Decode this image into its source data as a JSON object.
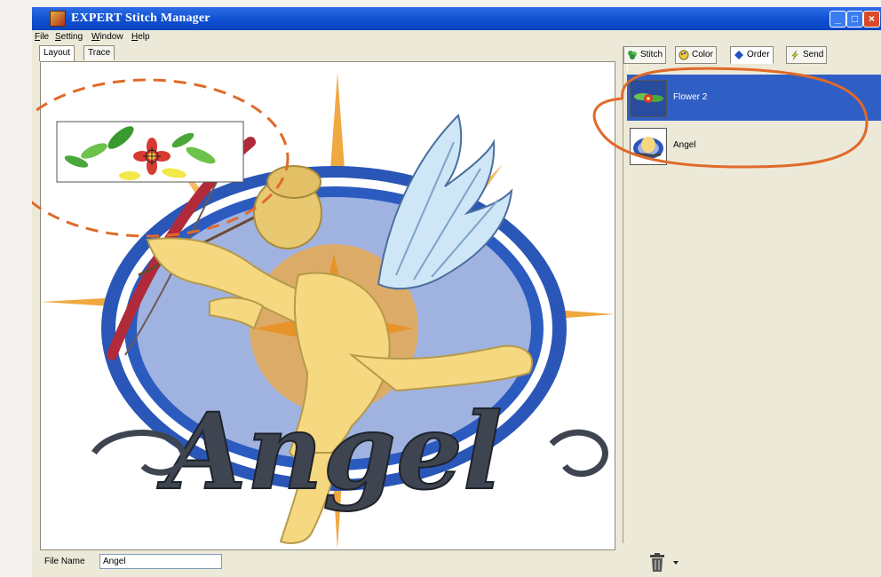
{
  "window": {
    "title": "EXPERT Stitch Manager",
    "controls": {
      "minimize": "_",
      "maximize": "□",
      "close": "×"
    }
  },
  "menu": [
    "File",
    "Setting",
    "Window",
    "Help"
  ],
  "left_tabs": [
    "Layout",
    "Trace"
  ],
  "active_left_tab": "Layout",
  "file_name": {
    "label": "File Name",
    "value": "Angel"
  },
  "right_tabs": [
    {
      "label": "Stitch",
      "icon": "stitch-icon"
    },
    {
      "label": "Color",
      "icon": "color-icon"
    },
    {
      "label": "Order",
      "icon": "order-icon"
    },
    {
      "label": "Send",
      "icon": "send-icon"
    }
  ],
  "active_right_tab": "Order",
  "order_list": [
    {
      "label": "Flower 2",
      "selected": true
    },
    {
      "label": "Angel",
      "selected": false
    }
  ],
  "footer_icons": [
    "trash-icon",
    "dropdown-arrow-icon"
  ],
  "design_text": "Angel",
  "colors": {
    "titlebar": "#0f4fd0",
    "selection": "#2f5fc4",
    "annotation": "#e06a2a",
    "outer_ring": "#2a56b8",
    "inner_oval": "#9fb2e0",
    "sun": "#f0a840",
    "angel": "#f6d880",
    "wings": "#cfe6f6",
    "bow": "#b02a3a",
    "script": "#3e4550"
  }
}
